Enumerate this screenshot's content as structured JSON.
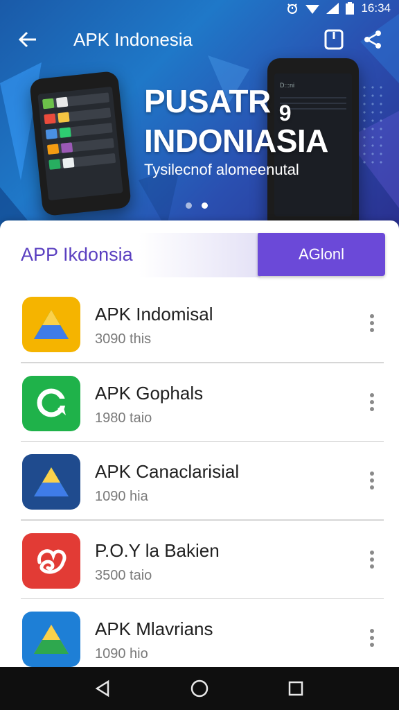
{
  "status_bar": {
    "time": "16:34",
    "icons": [
      "alarm-icon",
      "wifi-icon",
      "signal-icon",
      "battery-icon"
    ]
  },
  "toolbar": {
    "title": "APK Indonesia",
    "icons": [
      "back-arrow-icon",
      "bookmark-icon",
      "share-icon"
    ]
  },
  "hero": {
    "headline_line1": "PUSATR",
    "headline_mark": "9",
    "headline_line2": "INDONIASIA",
    "subtitle": "Tysilecnof alomeenutal",
    "phone_screen_label": "D:::ni",
    "pager": {
      "count": 2,
      "active": 1
    }
  },
  "section": {
    "title": "APP Ikdonsia",
    "button_label": "AGlonl"
  },
  "apps": [
    {
      "name": "APK Indomisal",
      "meta": "3090 this",
      "icon": "drive-triangle-icon",
      "bg": "#f5b400"
    },
    {
      "name": "APK Gophals",
      "meta": "1980 taio",
      "icon": "chat-bubble-icon",
      "bg": "#1fb24a"
    },
    {
      "name": "APK Canaclarisial",
      "meta": "1090 hia",
      "icon": "drive-triangle-icon",
      "bg": "#1f4b8e"
    },
    {
      "name": "P.O.Y la Bakien",
      "meta": "3500 taio",
      "icon": "swirl-logo-icon",
      "bg": "#e23b35"
    },
    {
      "name": "APK Mlavrians",
      "meta": "1090 hio",
      "icon": "drive-triangle-icon",
      "bg": "#1e7fd6"
    }
  ],
  "nav": {
    "icons": [
      "nav-back-icon",
      "nav-home-icon",
      "nav-recents-icon"
    ]
  },
  "colors": {
    "accent": "#6b49d8",
    "section_title": "#5a3fc0",
    "hero_bg": "#1f78c8"
  }
}
